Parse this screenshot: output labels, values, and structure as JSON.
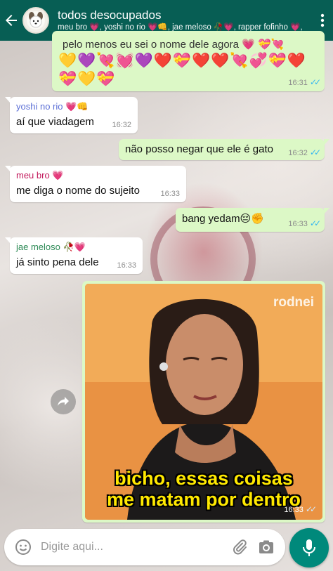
{
  "header": {
    "group_name": "todos desocupados",
    "members": "meu bro 💗, yoshi no rio 💗👊, jae meloso 🥀💗, rapper fofinho 💗,"
  },
  "messages": [
    {
      "type": "outgoing",
      "text": "pelo menos eu sei o nome dele agora 💗 💝💘",
      "emoji_line1": "💛💜💘💓💜❤️💝❤️❤️💘💞💝❤️",
      "emoji_line2": "💝💛💝",
      "time": "16:31",
      "ticks": "✓✓"
    },
    {
      "type": "incoming",
      "sender": "yoshi no rio 💗👊",
      "sender_color": "#5b6fd6",
      "text": "aí que viadagem",
      "time": "16:32"
    },
    {
      "type": "outgoing",
      "text": "não posso negar que ele é gato",
      "time": "16:32",
      "ticks": "✓✓"
    },
    {
      "type": "incoming",
      "sender": "meu bro 💗",
      "sender_color": "#c2185b",
      "text": "me diga o nome do sujeito",
      "time": "16:33"
    },
    {
      "type": "outgoing",
      "text": "bang yedam😔✊",
      "time": "16:33",
      "ticks": "✓✓"
    },
    {
      "type": "incoming",
      "sender": "jae meloso 🥀💗",
      "sender_color": "#2e8b57",
      "text": "já sinto pena dele",
      "time": "16:33"
    }
  ],
  "meme": {
    "watermark": "rodnei",
    "caption_line1": "bicho, essas coisas",
    "caption_line2": "me matam por dentro",
    "time": "16:33",
    "ticks": "✓✓"
  },
  "input": {
    "placeholder": "Digite aqui..."
  },
  "icons": {
    "back": "back-arrow-icon",
    "menu": "more-vert-icon",
    "emoji": "emoji-icon",
    "attach": "paperclip-icon",
    "camera": "camera-icon",
    "mic": "mic-icon",
    "forward": "forward-icon"
  },
  "colors": {
    "header": "#075e54",
    "outgoing": "#dcf8c6",
    "incoming": "#ffffff",
    "mic": "#00897b",
    "ticks": "#34b7f1"
  }
}
